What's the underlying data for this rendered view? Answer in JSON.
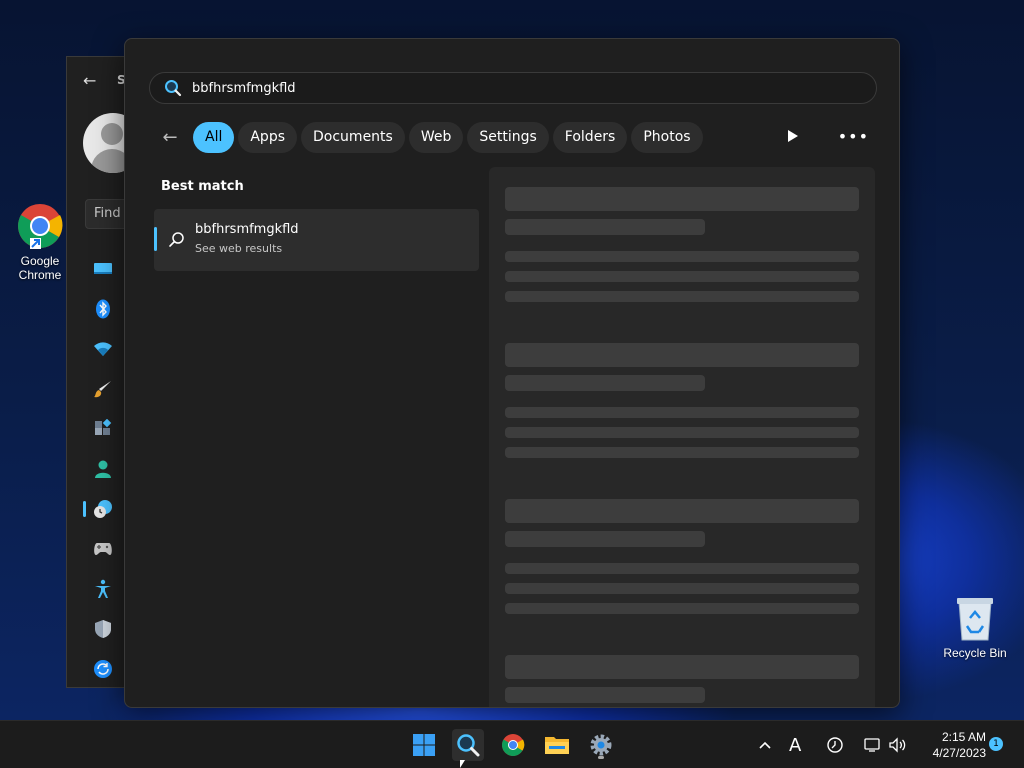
{
  "desktop": {
    "icons": [
      {
        "label": "Google Chrome"
      },
      {
        "label": "Recycle Bin"
      }
    ]
  },
  "settings_window": {
    "title": "S",
    "find_placeholder": "Find",
    "nav_icons": [
      "system-icon",
      "bluetooth-icon",
      "wifi-icon",
      "personalization-icon",
      "apps-icon",
      "accounts-icon",
      "time-language-icon",
      "gaming-icon",
      "accessibility-icon",
      "privacy-security-icon",
      "windows-update-icon"
    ]
  },
  "search": {
    "query": "bbfhrsmfmgkfld",
    "filters": [
      {
        "label": "All",
        "active": true
      },
      {
        "label": "Apps",
        "active": false
      },
      {
        "label": "Documents",
        "active": false
      },
      {
        "label": "Web",
        "active": false
      },
      {
        "label": "Settings",
        "active": false
      },
      {
        "label": "Folders",
        "active": false
      },
      {
        "label": "Photos",
        "active": false
      }
    ],
    "best_match_title": "Best match",
    "best_match": {
      "name": "bbfhrsmfmgkfld",
      "subtitle": "See web results"
    }
  },
  "taskbar": {
    "apps": [
      "start-icon",
      "search-icon",
      "chrome-icon",
      "file-explorer-icon",
      "settings-icon"
    ],
    "time": "2:15 AM",
    "date": "4/27/2023",
    "notification_count": "1"
  },
  "colors": {
    "accent": "#4cc2ff",
    "flyout_bg": "#1f1f1f",
    "taskbar_bg": "#1c1c1c"
  }
}
